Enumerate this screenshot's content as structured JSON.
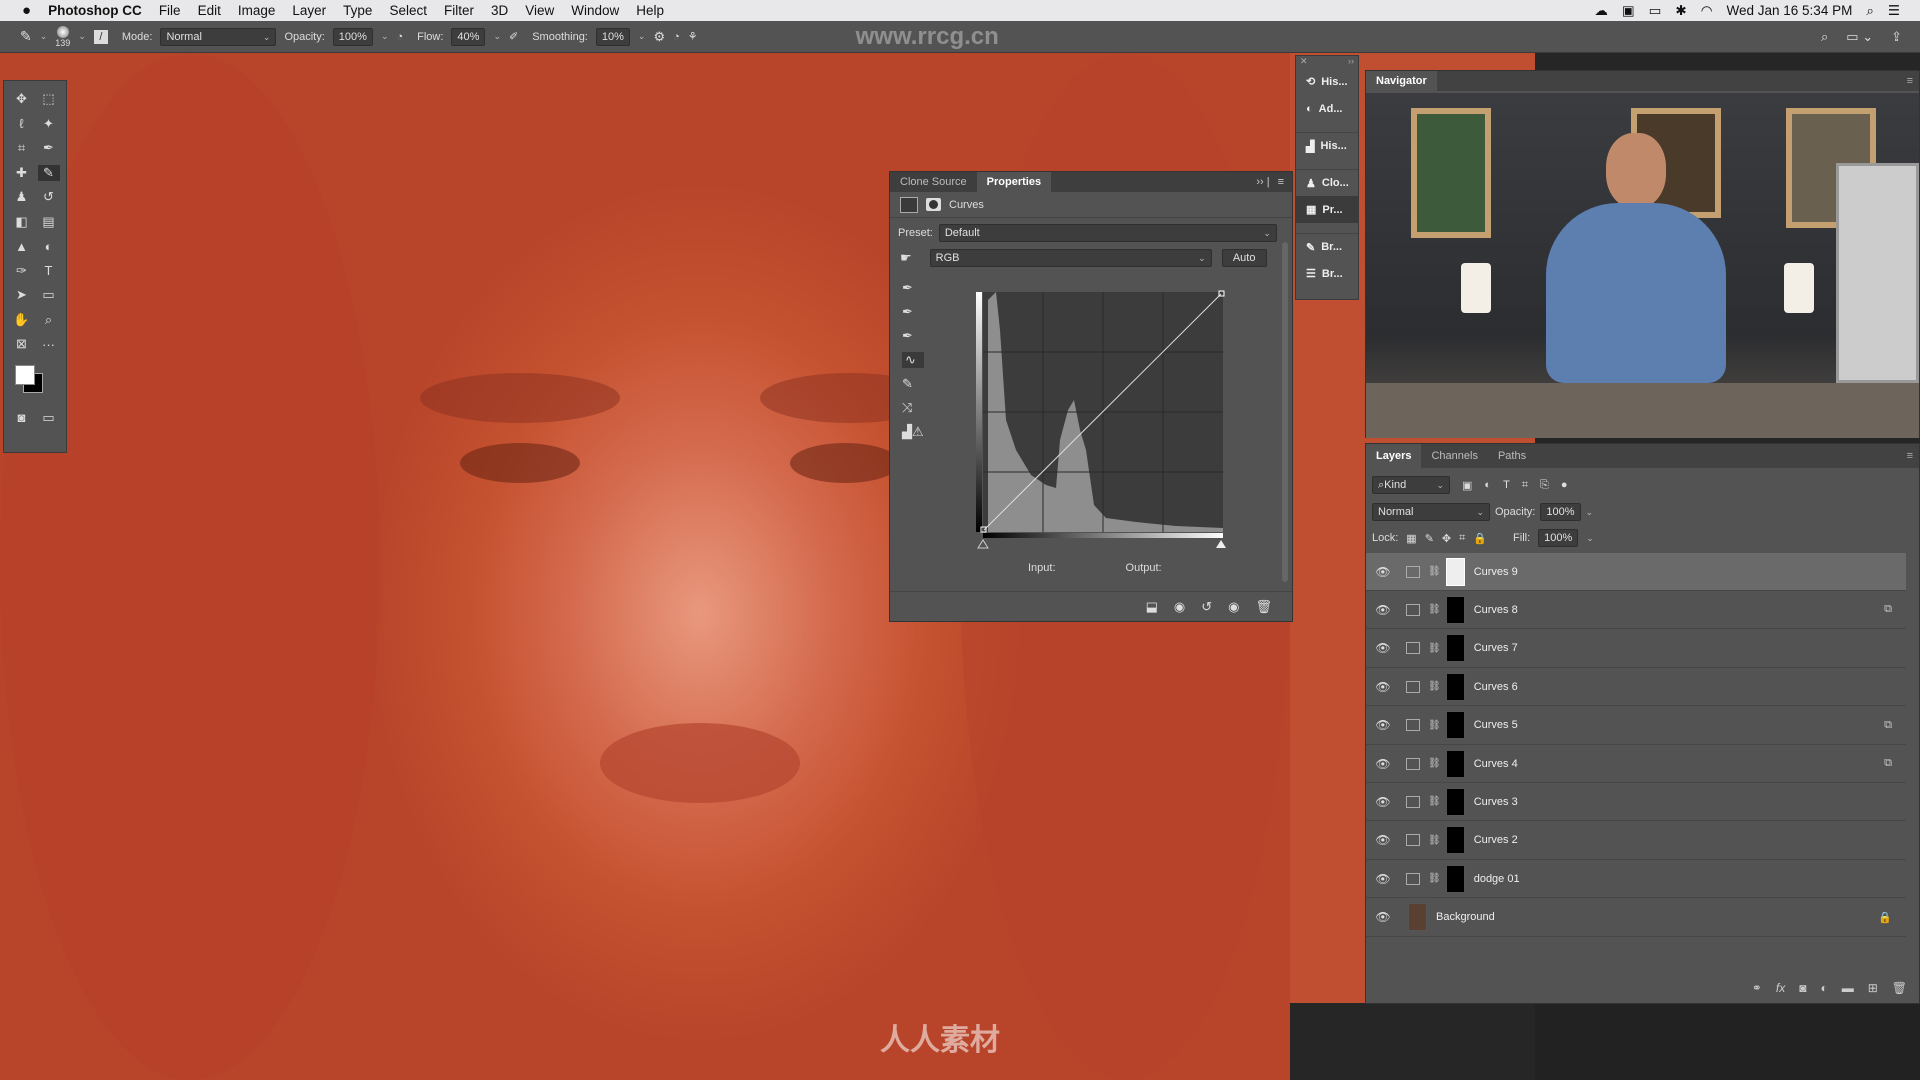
{
  "menubar": {
    "apple": "",
    "app": "Photoshop CC",
    "items": [
      "File",
      "Edit",
      "Image",
      "Layer",
      "Type",
      "Select",
      "Filter",
      "3D",
      "View",
      "Window",
      "Help"
    ],
    "clock": "Wed Jan 16  5:34 PM"
  },
  "options": {
    "brush_size": "139",
    "mode_label": "Mode:",
    "mode_value": "Normal",
    "opacity_label": "Opacity:",
    "opacity_value": "100%",
    "flow_label": "Flow:",
    "flow_value": "40%",
    "smoothing_label": "Smoothing:",
    "smoothing_value": "10%"
  },
  "watermark": "www.rrcg.cn",
  "watermark_logo": "人人素材",
  "dock": {
    "items": [
      "His...",
      "Ad...",
      "His...",
      "Clo...",
      "Pr...",
      "Br...",
      "Br..."
    ]
  },
  "navigator": {
    "title": "Navigator"
  },
  "properties": {
    "tabs": [
      "Clone Source",
      "Properties"
    ],
    "type": "Curves",
    "preset_label": "Preset:",
    "preset_value": "Default",
    "channel": "RGB",
    "auto": "Auto",
    "input_label": "Input:",
    "output_label": "Output:"
  },
  "layers": {
    "tabs": [
      "Layers",
      "Channels",
      "Paths"
    ],
    "filter": "Kind",
    "blend": "Normal",
    "opacity_label": "Opacity:",
    "opacity_value": "100%",
    "lock_label": "Lock:",
    "fill_label": "Fill:",
    "fill_value": "100%",
    "rows": [
      {
        "name": "Curves 9",
        "selected": true
      },
      {
        "name": "Curves 8"
      },
      {
        "name": "Curves 7"
      },
      {
        "name": "Curves 6"
      },
      {
        "name": "Curves 5"
      },
      {
        "name": "Curves 4"
      },
      {
        "name": "Curves 3"
      },
      {
        "name": "Curves 2"
      },
      {
        "name": "dodge 01"
      },
      {
        "name": "Background",
        "locked": true
      }
    ]
  },
  "colors": {
    "canvas": "#c4512f",
    "panel": "#535353",
    "menubar": "#e8e8ea"
  }
}
